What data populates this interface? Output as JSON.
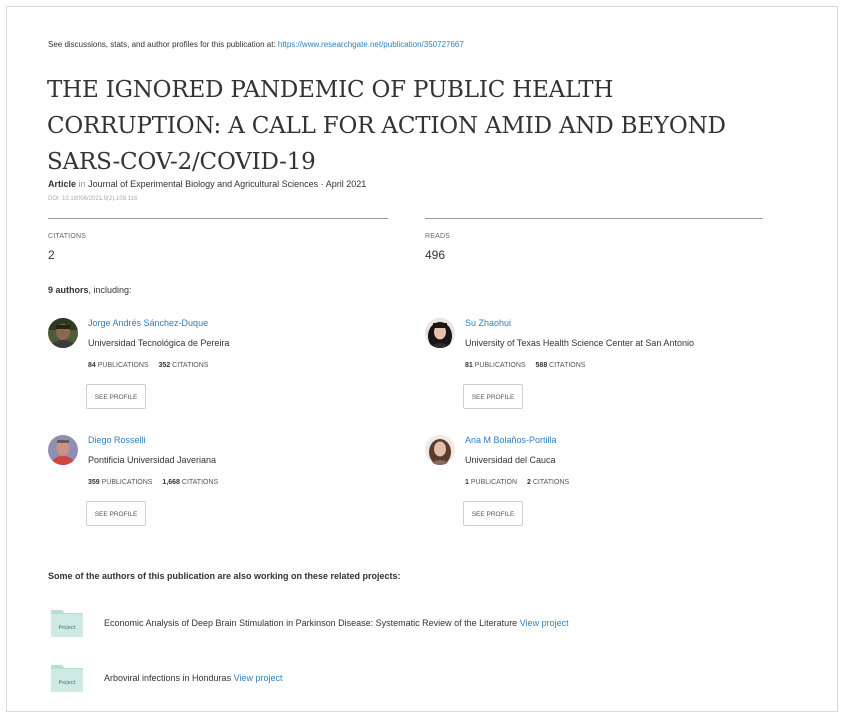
{
  "header": {
    "source_prefix": "See discussions, stats, and author profiles for this publication at:",
    "source_url": "https://www.researchgate.net/publication/350727667"
  },
  "title": "THE IGNORED PANDEMIC OF PUBLIC HEALTH CORRUPTION: A CALL FOR ACTION AMID AND BEYOND SARS-COV-2/COVID-19",
  "article": {
    "type": "Article",
    "in_word": "in",
    "journal": "Journal of Experimental Biology and Agricultural Sciences · April 2021",
    "doi": "DOI: 10.18006/2021.9(2).108.116"
  },
  "stats": {
    "citations_label": "CITATIONS",
    "citations_value": "2",
    "reads_label": "READS",
    "reads_value": "496"
  },
  "authors_heading": {
    "count": "9 authors",
    "suffix": ", including:"
  },
  "authors": [
    {
      "name": "Jorge Andrés Sánchez-Duque",
      "institution": "Universidad Tecnológica de Pereira",
      "publications": "84",
      "publications_label": "PUBLICATIONS",
      "citations": "352",
      "citations_label": "CITATIONS",
      "button": "SEE PROFILE"
    },
    {
      "name": "Su Zhaohui",
      "institution": "University of Texas Health Science Center at San Antonio",
      "publications": "81",
      "publications_label": "PUBLICATIONS",
      "citations": "588",
      "citations_label": "CITATIONS",
      "button": "SEE PROFILE"
    },
    {
      "name": "Diego Rosselli",
      "institution": "Pontificia Universidad Javeriana",
      "publications": "359",
      "publications_label": "PUBLICATIONS",
      "citations": "1,668",
      "citations_label": "CITATIONS",
      "button": "SEE PROFILE"
    },
    {
      "name": "Ana M Bolaños-Portilla",
      "institution": "Universidad del Cauca",
      "publications": "1",
      "publications_label": "PUBLICATION",
      "citations": "2",
      "citations_label": "CITATIONS",
      "button": "SEE PROFILE"
    }
  ],
  "related": {
    "heading": "Some of the authors of this publication are also working on these related projects:",
    "folder_label": "Project",
    "projects": [
      {
        "title": "Economic Analysis of Deep Brain Stimulation in Parkinson Disease: Systematic Review of the Literature",
        "link": "View project"
      },
      {
        "title": "Arboviral infections in Honduras",
        "link": "View project"
      }
    ]
  },
  "colors": {
    "link": "#2f7fc0",
    "folder": "#cfe9e4",
    "folder_tab": "#b9ded7",
    "rule": "#9a9a9a"
  }
}
